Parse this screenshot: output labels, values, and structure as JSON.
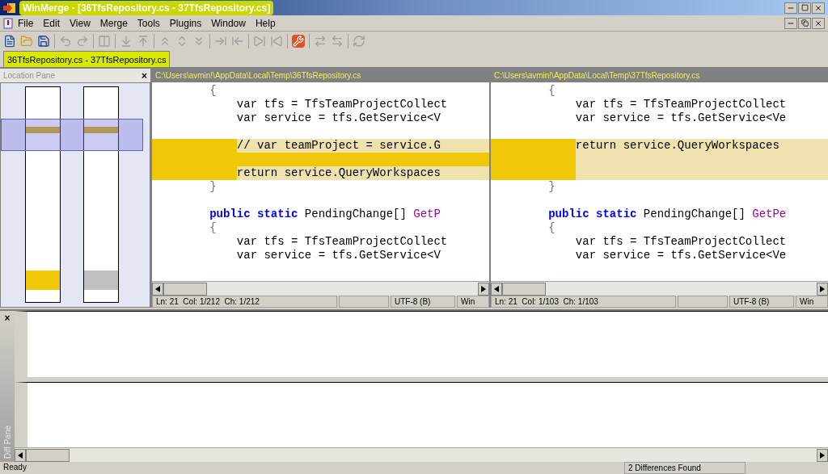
{
  "window": {
    "title": "WinMerge - [36TfsRepository.cs - 37TfsRepository.cs]"
  },
  "menu": [
    "File",
    "Edit",
    "View",
    "Merge",
    "Tools",
    "Plugins",
    "Window",
    "Help"
  ],
  "tabs": [
    {
      "label": "36TfsRepository.cs - 37TfsRepository.cs",
      "selected": true
    }
  ],
  "location_pane": {
    "title": "Location Pane",
    "close": "×"
  },
  "panes": [
    {
      "path": "C:\\Users\\avmin!\\AppData\\Local\\Temp\\36TfsRepository.cs",
      "lines": [
        {
          "kind": "same",
          "segments": [
            {
              "kind": "brace",
              "text": "        {"
            }
          ]
        },
        {
          "kind": "same",
          "segments": [
            {
              "kind": "plain",
              "text": "            var tfs = TfsTeamProjectCollect"
            }
          ]
        },
        {
          "kind": "same",
          "segments": [
            {
              "kind": "plain",
              "text": "            var service = tfs.GetService<V"
            }
          ]
        },
        {
          "kind": "same"
        },
        {
          "kind": "changed",
          "segments": [
            {
              "kind": "plain",
              "text": "            // var teamProject = service.G"
            }
          ]
        },
        {
          "kind": "filler"
        },
        {
          "kind": "changed",
          "segments": [
            {
              "kind": "plain",
              "text": "            return service.QueryWorkspaces"
            }
          ]
        },
        {
          "kind": "same",
          "segments": [
            {
              "kind": "brace",
              "text": "        }"
            }
          ]
        },
        {
          "kind": "same"
        },
        {
          "kind": "same",
          "segments": [
            {
              "kind": "keyword",
              "text": "        public static"
            },
            {
              "kind": "plain",
              "text": " PendingChange[] "
            },
            {
              "kind": "method",
              "text": "GetP"
            }
          ]
        },
        {
          "kind": "same",
          "segments": [
            {
              "kind": "brace",
              "text": "        {"
            }
          ]
        },
        {
          "kind": "same",
          "segments": [
            {
              "kind": "plain",
              "text": "            var tfs = TfsTeamProjectCollect"
            }
          ]
        },
        {
          "kind": "same",
          "segments": [
            {
              "kind": "plain",
              "text": "            var service = tfs.GetService<V"
            }
          ]
        }
      ],
      "status": [
        "Ln: 21  Col: 1/212  Ch: 1/212",
        "UTF-8 (B)",
        "Win"
      ]
    },
    {
      "path": "C:\\Users\\avmin!\\AppData\\Local\\Temp\\37TfsRepository.cs",
      "lines": [
        {
          "kind": "same",
          "segments": [
            {
              "kind": "brace",
              "text": "        {"
            }
          ]
        },
        {
          "kind": "same",
          "segments": [
            {
              "kind": "plain",
              "text": "            var tfs = TfsTeamProjectCollect"
            }
          ]
        },
        {
          "kind": "same",
          "segments": [
            {
              "kind": "plain",
              "text": "            var service = tfs.GetService<Ve"
            }
          ]
        },
        {
          "kind": "same"
        },
        {
          "kind": "changed",
          "segments": [
            {
              "kind": "plain",
              "text": "            return service.QueryWorkspaces"
            }
          ]
        },
        {
          "kind": "changed"
        },
        {
          "kind": "changed"
        },
        {
          "kind": "same",
          "segments": [
            {
              "kind": "brace",
              "text": "        }"
            }
          ]
        },
        {
          "kind": "same"
        },
        {
          "kind": "same",
          "segments": [
            {
              "kind": "keyword",
              "text": "        public static"
            },
            {
              "kind": "plain",
              "text": " PendingChange[] "
            },
            {
              "kind": "method",
              "text": "GetPe"
            }
          ]
        },
        {
          "kind": "same",
          "segments": [
            {
              "kind": "brace",
              "text": "        {"
            }
          ]
        },
        {
          "kind": "same",
          "segments": [
            {
              "kind": "plain",
              "text": "            var tfs = TfsTeamProjectCollect"
            }
          ]
        },
        {
          "kind": "same",
          "segments": [
            {
              "kind": "plain",
              "text": "            var service = tfs.GetService<Ve"
            }
          ]
        }
      ],
      "status": [
        "Ln: 21  Col: 1/103  Ch: 1/103",
        "UTF-8 (B)",
        "Win"
      ]
    }
  ],
  "diff_pane": {
    "title": "Diff Pane",
    "close": "×"
  },
  "status_bar": [
    "Ready",
    "2 Differences Found"
  ]
}
